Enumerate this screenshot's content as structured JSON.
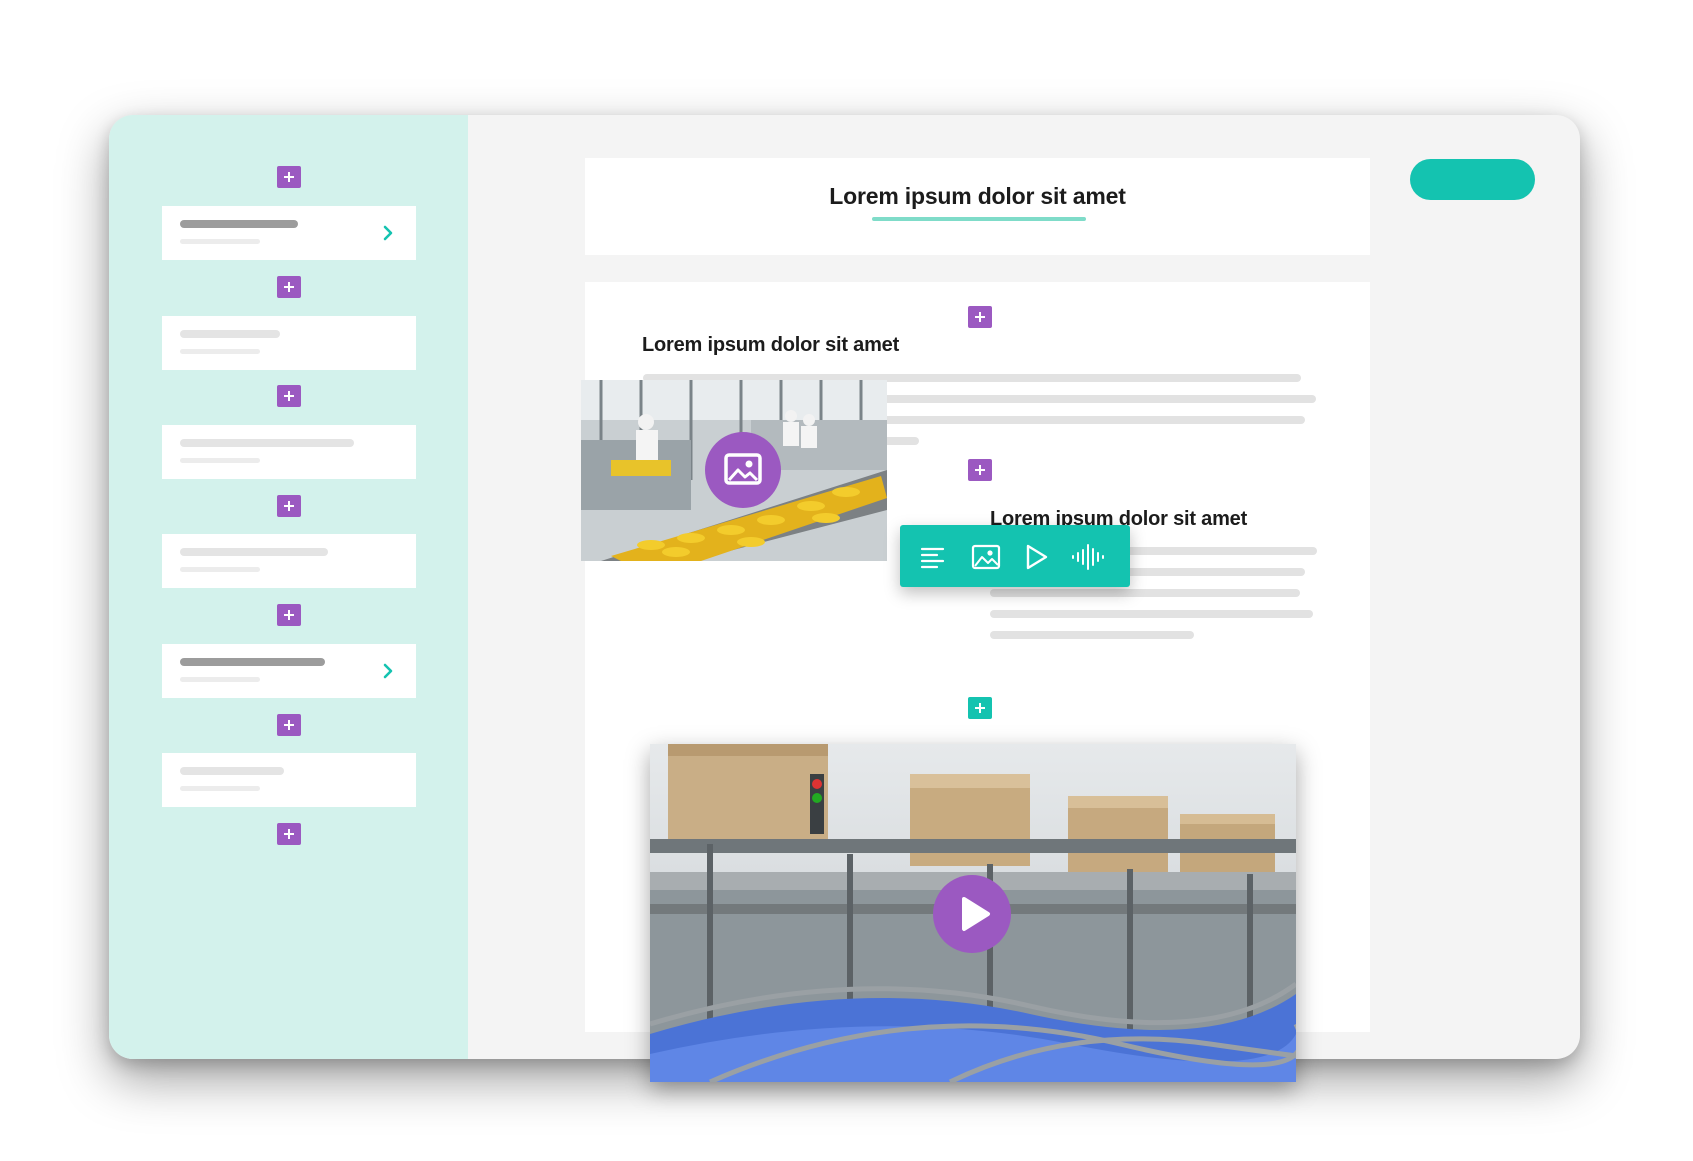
{
  "editor": {
    "title": "Lorem ipsum dolor sit amet",
    "section1_heading": "Lorem ipsum dolor sit amet",
    "section2_heading": "Lorem ipsum dolor sit amet"
  },
  "toolbar": {
    "items": [
      "text-lines-icon",
      "image-icon",
      "play-icon",
      "audio-waveform-icon"
    ]
  },
  "sidebar": {
    "item_count": 6,
    "expandable_items": [
      1,
      5
    ]
  },
  "colors": {
    "accent_teal": "#14c3b0",
    "accent_purple": "#9b59c1",
    "sidebar_bg": "#d3f2ec",
    "title_underline": "#7fdcc9"
  }
}
